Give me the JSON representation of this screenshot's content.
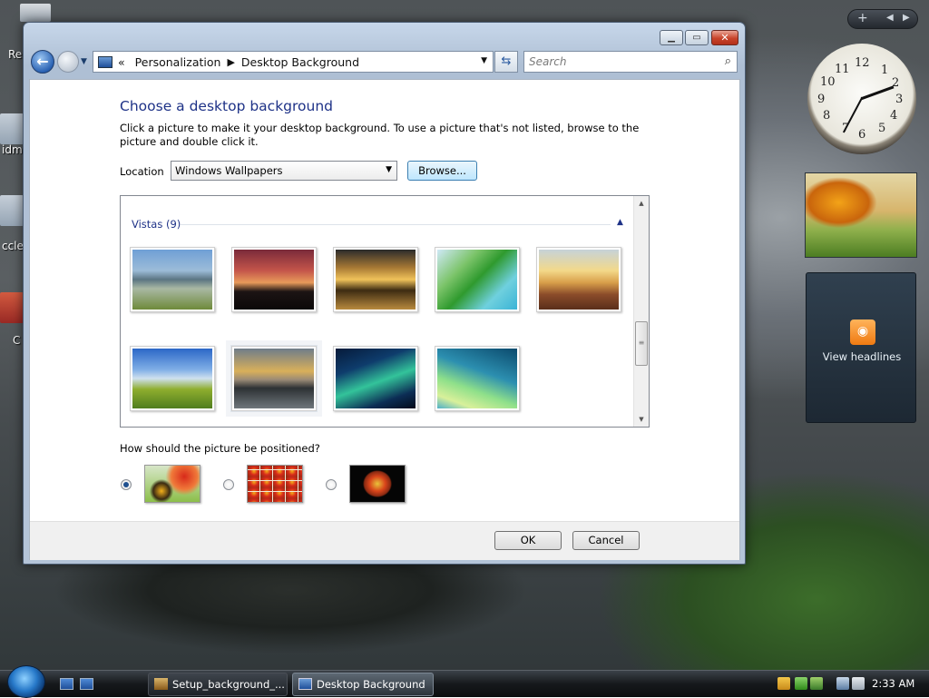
{
  "desktop": {
    "icon_labels": [
      "Re",
      "idm",
      "ccle",
      "C"
    ]
  },
  "window": {
    "breadcrumb": {
      "root_chevron": "«",
      "items": [
        "Personalization",
        "Desktop Background"
      ]
    },
    "search": {
      "placeholder": "Search"
    },
    "content": {
      "title": "Choose a desktop background",
      "description": "Click a picture to make it your desktop background. To use a picture that's not listed, browse to the picture and double click it.",
      "location_label": "Location",
      "location_value": "Windows Wallpapers",
      "browse_label": "Browse...",
      "group_label": "Vistas (9)",
      "wallpapers": [
        {
          "name": "vista-mountain-lake",
          "selected": false
        },
        {
          "name": "vista-dusk-hills",
          "selected": false
        },
        {
          "name": "vista-rocky-sunset",
          "selected": false
        },
        {
          "name": "vista-palm-leaf",
          "selected": false
        },
        {
          "name": "vista-golden-grass",
          "selected": false
        },
        {
          "name": "vista-green-hills",
          "selected": false
        },
        {
          "name": "vista-mountain-reflection",
          "selected": true
        },
        {
          "name": "vista-aurora",
          "selected": false
        },
        {
          "name": "vista-aurora-green",
          "selected": false
        }
      ],
      "position_label": "How should the picture be positioned?",
      "position_options": [
        {
          "name": "fit-to-screen",
          "selected": true
        },
        {
          "name": "tile",
          "selected": false
        },
        {
          "name": "center",
          "selected": false
        }
      ]
    },
    "buttons": {
      "ok": "OK",
      "cancel": "Cancel"
    }
  },
  "sidebar": {
    "clock_numbers": [
      "12",
      "1",
      "2",
      "3",
      "4",
      "5",
      "6",
      "7",
      "8",
      "9",
      "10",
      "11"
    ],
    "feed_label": "View headlines"
  },
  "taskbar": {
    "tasks": [
      {
        "label": "Setup_background_...",
        "active": false
      },
      {
        "label": "Desktop Background",
        "active": true
      }
    ],
    "time": "2:33 AM"
  },
  "colors": {
    "title_blue": "#1e3287",
    "taskbar": "#16191c",
    "feed_orange": "#ef7a12"
  }
}
